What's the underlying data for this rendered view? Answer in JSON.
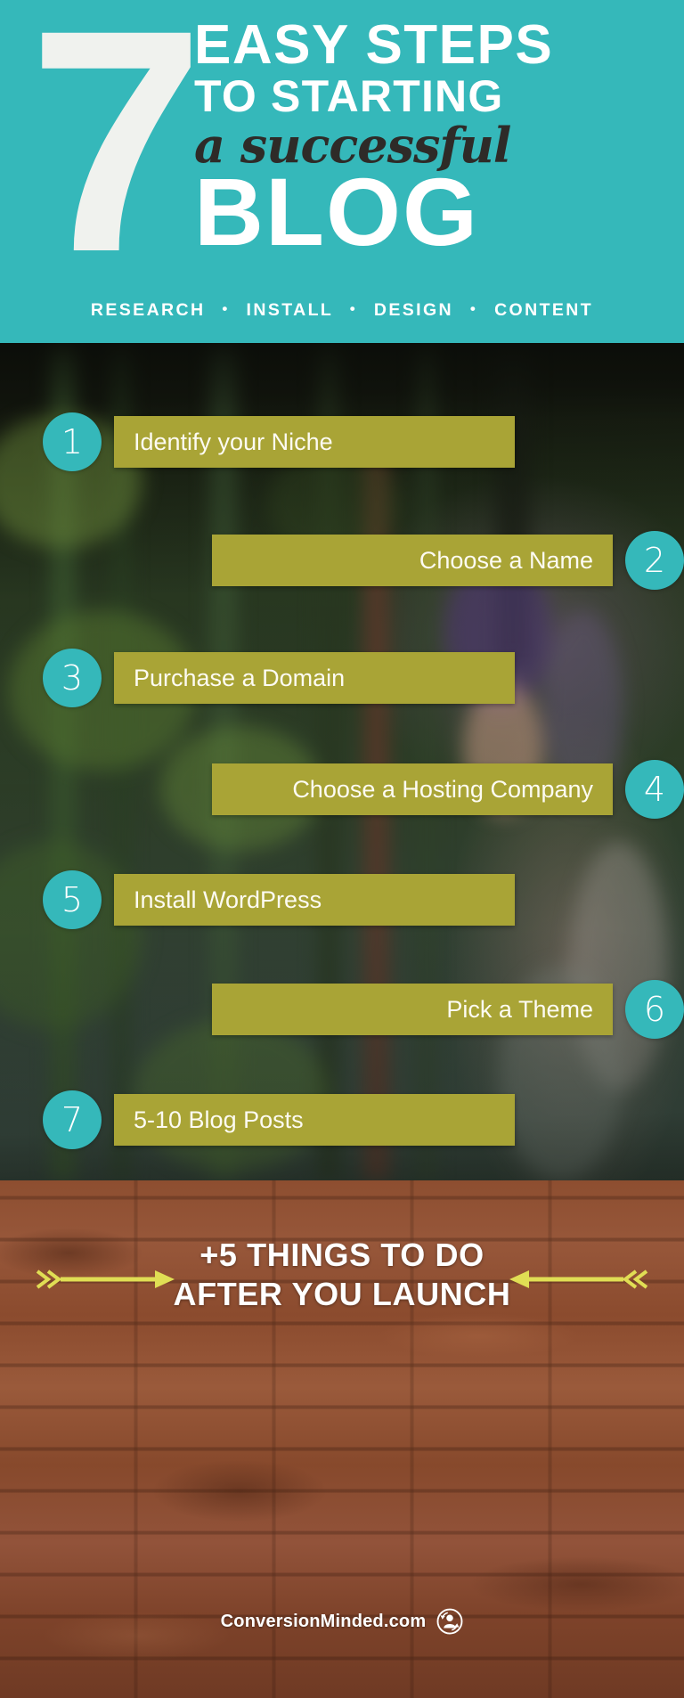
{
  "header": {
    "number": "7",
    "line1": "EASY STEPS",
    "line2": "TO STARTING",
    "script_line": "a successful",
    "line3": "BLOG",
    "tagline": [
      "RESEARCH",
      "INSTALL",
      "DESIGN",
      "CONTENT"
    ],
    "tagline_separator": "•",
    "bg_color": "#35B8BA",
    "text_color": "#FFFFFF",
    "script_color": "#2E2B28"
  },
  "steps": {
    "circle_color": "#35B8BA",
    "bar_color": "#A9A436",
    "label_color": "#FDFBF2",
    "items": [
      {
        "number": "1",
        "label": "Identify your Niche",
        "side": "left"
      },
      {
        "number": "2",
        "label": "Choose a Name",
        "side": "right"
      },
      {
        "number": "3",
        "label": "Purchase a Domain",
        "side": "left"
      },
      {
        "number": "4",
        "label": "Choose a Hosting Company",
        "side": "right"
      },
      {
        "number": "5",
        "label": "Install WordPress",
        "side": "left"
      },
      {
        "number": "6",
        "label": "Pick a Theme",
        "side": "right"
      },
      {
        "number": "7",
        "label": "5-10 Blog Posts",
        "side": "left"
      }
    ]
  },
  "footer": {
    "cta_line1": "+5 THINGS TO DO",
    "cta_line2": "AFTER YOU LAUNCH",
    "arrow_color": "#E0DE54",
    "brand_name": "ConversionMinded.com",
    "brand_text_color": "#FFFFFF",
    "brick_color": "#8D4E30"
  }
}
